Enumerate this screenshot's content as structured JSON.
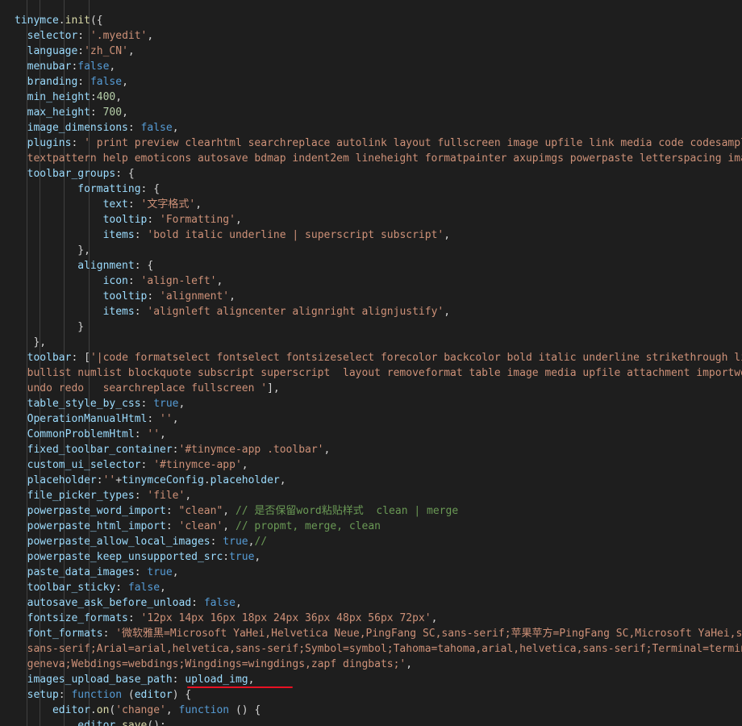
{
  "colors": {
    "background": "#1e1e1e",
    "default": "#d4d4d4",
    "property": "#9cdcfe",
    "string": "#ce9178",
    "keyword": "#569cd6",
    "number": "#b5cea8",
    "comment": "#6a9955",
    "function": "#dcdcaa",
    "highlight_underline": "#e81123"
  },
  "lines": [
    [
      [
        "tinymce",
        "p"
      ],
      [
        ".",
        "d"
      ],
      [
        "init",
        "f"
      ],
      [
        "({",
        "d"
      ]
    ],
    [
      [
        "  selector",
        "p"
      ],
      [
        ": ",
        "d"
      ],
      [
        "'.myedit'",
        "s"
      ],
      [
        ",",
        "d"
      ]
    ],
    [
      [
        "  language",
        "p"
      ],
      [
        ":",
        "d"
      ],
      [
        "'zh_CN'",
        "s"
      ],
      [
        ",",
        "d"
      ]
    ],
    [
      [
        "  menubar",
        "p"
      ],
      [
        ":",
        "d"
      ],
      [
        "false",
        "k"
      ],
      [
        ",",
        "d"
      ]
    ],
    [
      [
        "  branding",
        "p"
      ],
      [
        ": ",
        "d"
      ],
      [
        "false",
        "k"
      ],
      [
        ",",
        "d"
      ]
    ],
    [
      [
        "  min_height",
        "p"
      ],
      [
        ":",
        "d"
      ],
      [
        "400",
        "n"
      ],
      [
        ",",
        "d"
      ]
    ],
    [
      [
        "  max_height",
        "p"
      ],
      [
        ": ",
        "d"
      ],
      [
        "700",
        "n"
      ],
      [
        ",",
        "d"
      ]
    ],
    [
      [
        "  image_dimensions",
        "p"
      ],
      [
        ": ",
        "d"
      ],
      [
        "false",
        "k"
      ],
      [
        ",",
        "d"
      ]
    ],
    [
      [
        "  plugins",
        "p"
      ],
      [
        ": ",
        "d"
      ],
      [
        "' print preview clearhtml searchreplace autolink layout fullscreen image upfile link media code codesample table charmap hr pagebreak",
        "s"
      ]
    ],
    [
      [
        "  textpattern help emoticons autosave bdmap indent2em lineheight formatpainter axupimgs powerpaste letterspacing imagetools quickbars attachment table importword',",
        "s"
      ]
    ],
    [
      [
        "  toolbar_groups",
        "p"
      ],
      [
        ": {",
        "d"
      ]
    ],
    [
      [
        "          formatting",
        "p"
      ],
      [
        ": {",
        "d"
      ]
    ],
    [
      [
        "              text",
        "p"
      ],
      [
        ": ",
        "d"
      ],
      [
        "'文字格式'",
        "s"
      ],
      [
        ",",
        "d"
      ]
    ],
    [
      [
        "              tooltip",
        "p"
      ],
      [
        ": ",
        "d"
      ],
      [
        "'Formatting'",
        "s"
      ],
      [
        ",",
        "d"
      ]
    ],
    [
      [
        "              items",
        "p"
      ],
      [
        ": ",
        "d"
      ],
      [
        "'bold italic underline | superscript subscript'",
        "s"
      ],
      [
        ",",
        "d"
      ]
    ],
    [
      [
        "          },",
        "d"
      ]
    ],
    [
      [
        "          alignment",
        "p"
      ],
      [
        ": {",
        "d"
      ]
    ],
    [
      [
        "              icon",
        "p"
      ],
      [
        ": ",
        "d"
      ],
      [
        "'align-left'",
        "s"
      ],
      [
        ",",
        "d"
      ]
    ],
    [
      [
        "              tooltip",
        "p"
      ],
      [
        ": ",
        "d"
      ],
      [
        "'alignment'",
        "s"
      ],
      [
        ",",
        "d"
      ]
    ],
    [
      [
        "              items",
        "p"
      ],
      [
        ": ",
        "d"
      ],
      [
        "'alignleft aligncenter alignright alignjustify'",
        "s"
      ],
      [
        ",",
        "d"
      ]
    ],
    [
      [
        "          }",
        "d"
      ]
    ],
    [
      [
        "   },",
        "d"
      ]
    ],
    [
      [
        "  toolbar",
        "p"
      ],
      [
        ": [",
        "d"
      ],
      [
        "'|code formatselect fontselect fontsizeselect forecolor backcolor bold italic underline strikethrough link alignment",
        "s"
      ]
    ],
    [
      [
        "  bullist numlist blockquote subscript superscript  layout removeformat table image media upfile attachment importword axupimgs",
        "s"
      ]
    ],
    [
      [
        "  undo redo   searchreplace fullscreen '",
        "s"
      ],
      [
        "],",
        "d"
      ]
    ],
    [
      [
        "  table_style_by_css",
        "p"
      ],
      [
        ": ",
        "d"
      ],
      [
        "true",
        "k"
      ],
      [
        ",",
        "d"
      ]
    ],
    [
      [
        "  OperationManualHtml",
        "p"
      ],
      [
        ": ",
        "d"
      ],
      [
        "''",
        "s"
      ],
      [
        ",",
        "d"
      ]
    ],
    [
      [
        "  CommonProblemHtml",
        "p"
      ],
      [
        ": ",
        "d"
      ],
      [
        "''",
        "s"
      ],
      [
        ",",
        "d"
      ]
    ],
    [
      [
        "  fixed_toolbar_container",
        "p"
      ],
      [
        ":",
        "d"
      ],
      [
        "'#tinymce-app .toolbar'",
        "s"
      ],
      [
        ",",
        "d"
      ]
    ],
    [
      [
        "  custom_ui_selector",
        "p"
      ],
      [
        ": ",
        "d"
      ],
      [
        "'#tinymce-app'",
        "s"
      ],
      [
        ",",
        "d"
      ]
    ],
    [
      [
        "  placeholder",
        "p"
      ],
      [
        ":",
        "d"
      ],
      [
        "''",
        "s"
      ],
      [
        "+",
        "d"
      ],
      [
        "tinymceConfig",
        "p"
      ],
      [
        ".",
        "d"
      ],
      [
        "placeholder",
        "p"
      ],
      [
        ",",
        "d"
      ]
    ],
    [
      [
        "  file_picker_types",
        "p"
      ],
      [
        ": ",
        "d"
      ],
      [
        "'file'",
        "s"
      ],
      [
        ",",
        "d"
      ]
    ],
    [
      [
        "  powerpaste_word_import",
        "p"
      ],
      [
        ": ",
        "d"
      ],
      [
        "\"clean\"",
        "s"
      ],
      [
        ", ",
        "d"
      ],
      [
        "// 是否保留word粘贴样式  clean | merge",
        "c"
      ]
    ],
    [
      [
        "  powerpaste_html_import",
        "p"
      ],
      [
        ": ",
        "d"
      ],
      [
        "'clean'",
        "s"
      ],
      [
        ", ",
        "d"
      ],
      [
        "// propmt, merge, clean",
        "c"
      ]
    ],
    [
      [
        "  powerpaste_allow_local_images",
        "p"
      ],
      [
        ": ",
        "d"
      ],
      [
        "true",
        "k"
      ],
      [
        ",",
        "d"
      ],
      [
        "//",
        "c"
      ]
    ],
    [
      [
        "  powerpaste_keep_unsupported_src",
        "p"
      ],
      [
        ":",
        "d"
      ],
      [
        "true",
        "k"
      ],
      [
        ",",
        "d"
      ]
    ],
    [
      [
        "  paste_data_images",
        "p"
      ],
      [
        ": ",
        "d"
      ],
      [
        "true",
        "k"
      ],
      [
        ",",
        "d"
      ]
    ],
    [
      [
        "  toolbar_sticky",
        "p"
      ],
      [
        ": ",
        "d"
      ],
      [
        "false",
        "k"
      ],
      [
        ",",
        "d"
      ]
    ],
    [
      [
        "  autosave_ask_before_unload",
        "p"
      ],
      [
        ": ",
        "d"
      ],
      [
        "false",
        "k"
      ],
      [
        ",",
        "d"
      ]
    ],
    [
      [
        "  fontsize_formats",
        "p"
      ],
      [
        ": ",
        "d"
      ],
      [
        "'12px 14px 16px 18px 24px 36px 48px 56px 72px'",
        "s"
      ],
      [
        ",",
        "d"
      ]
    ],
    [
      [
        "  font_formats",
        "p"
      ],
      [
        ": ",
        "d"
      ],
      [
        "'微软雅黑=Microsoft YaHei,Helvetica Neue,PingFang SC,sans-serif;苹果苹方=PingFang SC,Microsoft YaHei,sans-serif;宋体=simsun,serif;",
        "s"
      ]
    ],
    [
      [
        "  sans-serif;Arial=arial,helvetica,sans-serif;Symbol=symbol;Tahoma=tahoma,arial,helvetica,sans-serif;Terminal=terminal,monaco;Times New Roman=times new roman,times;Verdana=verdana,",
        "s"
      ]
    ],
    [
      [
        "  geneva;Webdings=webdings;Wingdings=wingdings,zapf dingbats;'",
        "s"
      ],
      [
        ",",
        "d"
      ]
    ],
    [
      [
        "  images_upload_base_path",
        "p"
      ],
      [
        ": ",
        "d"
      ],
      [
        "upload_img",
        "p"
      ],
      [
        ",",
        "d"
      ]
    ],
    [
      [
        "  setup",
        "p"
      ],
      [
        ": ",
        "d"
      ],
      [
        "function",
        "k"
      ],
      [
        " (",
        "d"
      ],
      [
        "editor",
        "p"
      ],
      [
        ") {",
        "d"
      ]
    ],
    [
      [
        "      editor",
        "p"
      ],
      [
        ".",
        "d"
      ],
      [
        "on",
        "f"
      ],
      [
        "(",
        "d"
      ],
      [
        "'change'",
        "s"
      ],
      [
        ", ",
        "d"
      ],
      [
        "function",
        "k"
      ],
      [
        " () {",
        "d"
      ]
    ],
    [
      [
        "          editor",
        "p"
      ],
      [
        ".",
        "d"
      ],
      [
        "save",
        "f"
      ],
      [
        "();",
        "d"
      ]
    ]
  ]
}
